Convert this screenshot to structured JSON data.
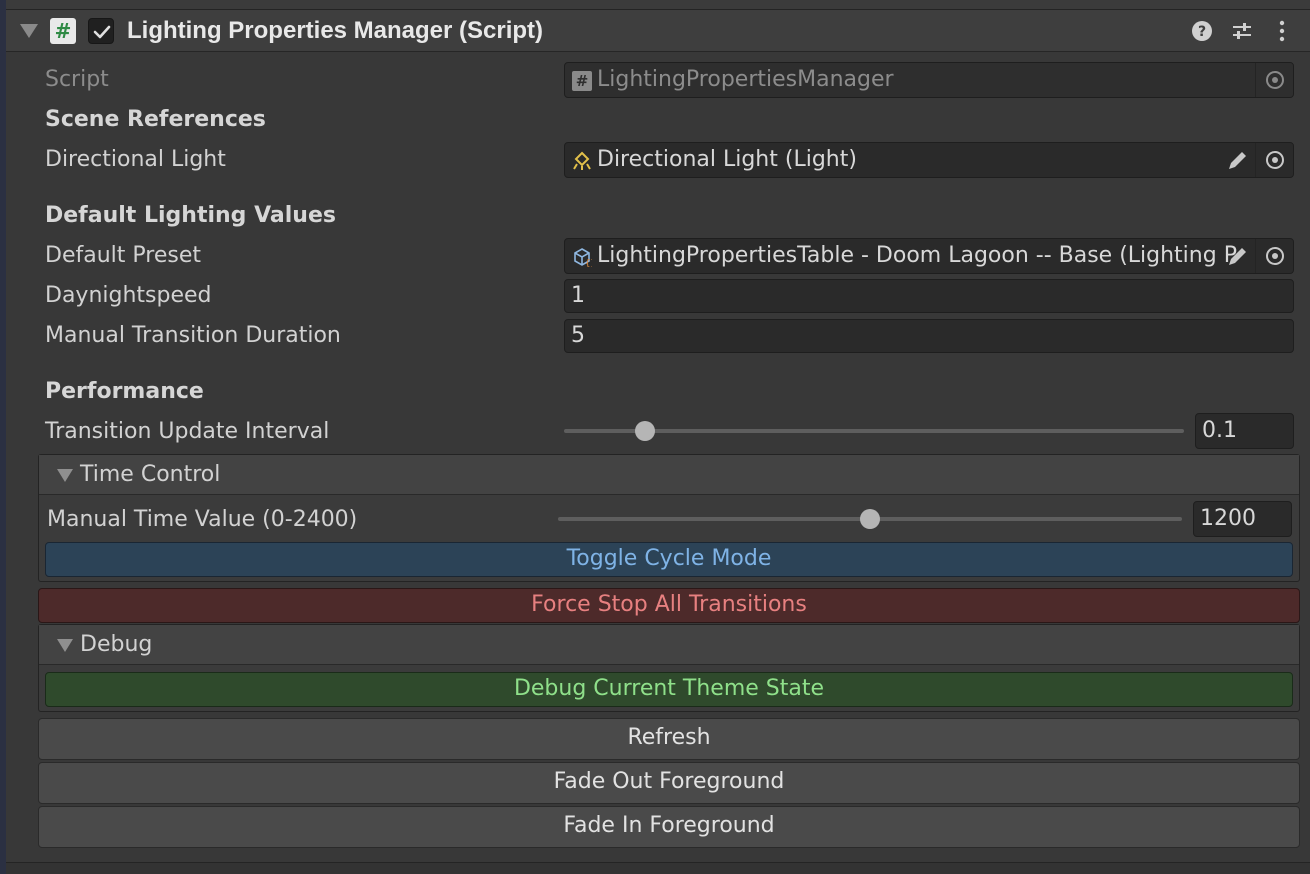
{
  "component": {
    "title": "Lighting Properties Manager (Script)",
    "enabled": true
  },
  "fields": {
    "script_label": "Script",
    "script_value": "LightingPropertiesManager",
    "scene_references": "Scene References",
    "directional_light_label": "Directional Light",
    "directional_light_value": "Directional Light (Light)",
    "default_lighting_values": "Default Lighting Values",
    "default_preset_label": "Default Preset",
    "default_preset_value": "LightingPropertiesTable - Doom Lagoon -- Base (Lighting P",
    "daynightspeed_label": "Daynightspeed",
    "daynightspeed_value": "1",
    "manual_transition_label": "Manual Transition Duration",
    "manual_transition_value": "5",
    "performance": "Performance",
    "transition_interval_label": "Transition Update Interval",
    "transition_interval_value": "0.1"
  },
  "time_control": {
    "header": "Time Control",
    "manual_time_label": "Manual Time Value (0-2400)",
    "manual_time_value": "1200",
    "toggle_cycle_label": "Toggle Cycle Mode"
  },
  "force_stop_label": "Force Stop All Transitions",
  "debug": {
    "header": "Debug",
    "debug_state_label": "Debug Current Theme State"
  },
  "buttons": {
    "refresh": "Refresh",
    "fade_out": "Fade Out Foreground",
    "fade_in": "Fade In Foreground"
  },
  "sliders": {
    "transition_interval_fraction": 0.13,
    "manual_time_fraction": 0.5
  },
  "colors": {
    "toggle_cycle_text": "#7fb3e6",
    "force_stop_text": "#e78080",
    "debug_state_text": "#8fe08a"
  }
}
